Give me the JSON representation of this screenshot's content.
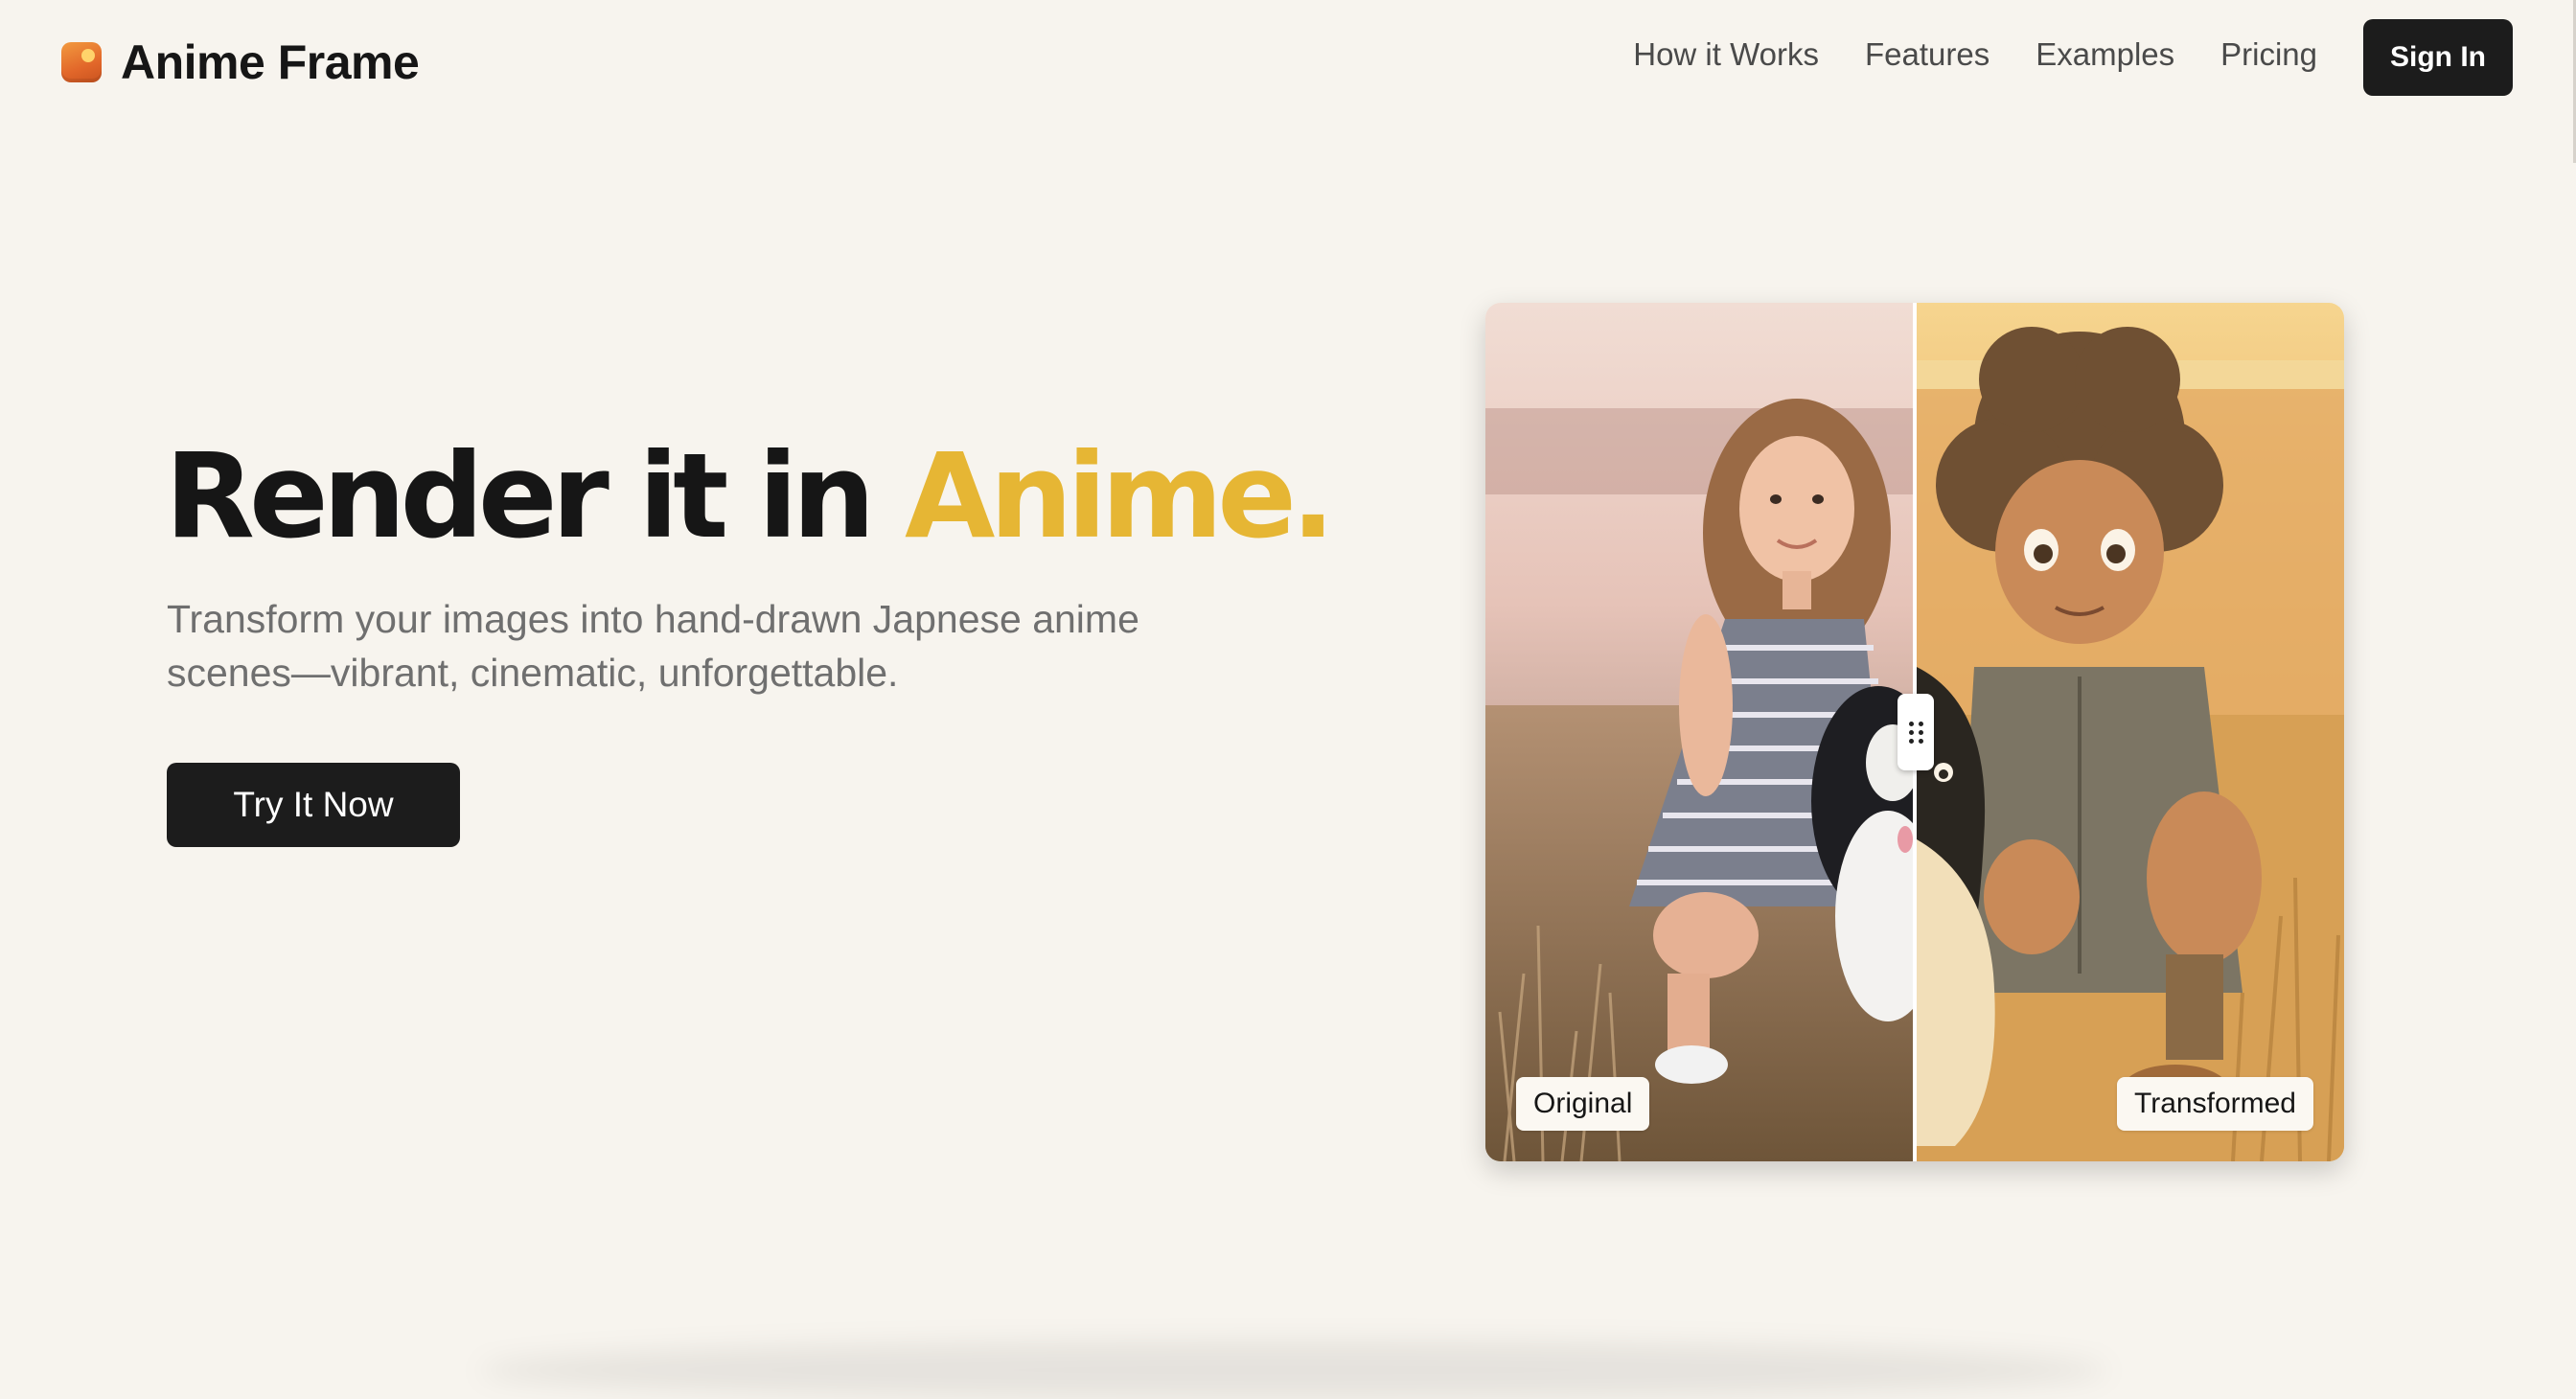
{
  "brand": {
    "name": "Anime Frame",
    "accent_color": "#e6b634",
    "icon": "anime-frame-logo-icon"
  },
  "nav": {
    "links": [
      {
        "label": "How it Works"
      },
      {
        "label": "Features"
      },
      {
        "label": "Examples"
      },
      {
        "label": "Pricing"
      }
    ],
    "signin_label": "Sign In"
  },
  "hero": {
    "title_main": "Render it in",
    "title_accent": "Anime.",
    "subtitle": "Transform your images into hand-drawn Japnese anime scenes—vibrant, cinematic, unforgettable.",
    "cta_label": "Try It Now"
  },
  "comparison": {
    "original_label": "Original",
    "transformed_label": "Transformed",
    "slider_position": 0.5,
    "handle_icon": "drag-handle-icon"
  }
}
